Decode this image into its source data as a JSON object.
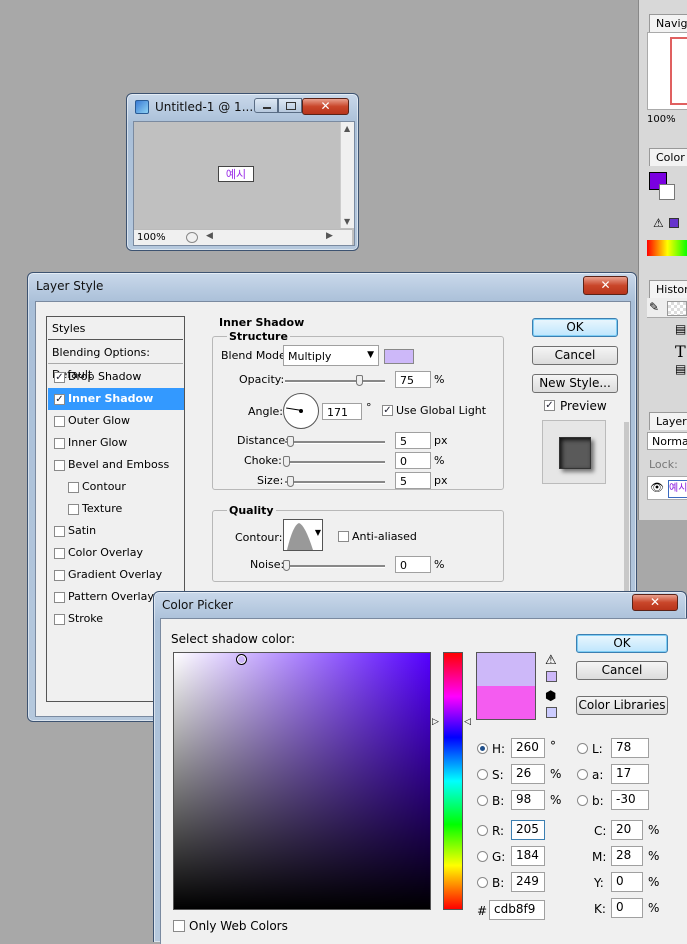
{
  "doc_window": {
    "title": "Untitled-1 @ 1...",
    "zoom": "100%",
    "content_text": "예시"
  },
  "right_panels": {
    "navigator_tab": "Navigat",
    "navigator_zoom": "100%",
    "color_tab": "Color",
    "history_tab": "History",
    "layers_tab": "Layers",
    "blend_mode": "Normal",
    "lock_label": "Lock:",
    "layer_name": "예시",
    "fg_color": "#7a00e0",
    "history_item": "T"
  },
  "layer_style": {
    "title": "Layer Style",
    "ok": "OK",
    "cancel": "Cancel",
    "new_style": "New Style...",
    "preview_label": "Preview",
    "styles_header": "Styles",
    "blending_options": "Blending Options: Default",
    "items": [
      {
        "label": "Drop Shadow",
        "checked": true,
        "selected": false,
        "indent": false
      },
      {
        "label": "Inner Shadow",
        "checked": true,
        "selected": true,
        "indent": false
      },
      {
        "label": "Outer Glow",
        "checked": false,
        "selected": false,
        "indent": false
      },
      {
        "label": "Inner Glow",
        "checked": false,
        "selected": false,
        "indent": false
      },
      {
        "label": "Bevel and Emboss",
        "checked": false,
        "selected": false,
        "indent": false
      },
      {
        "label": "Contour",
        "checked": false,
        "selected": false,
        "indent": true
      },
      {
        "label": "Texture",
        "checked": false,
        "selected": false,
        "indent": true
      },
      {
        "label": "Satin",
        "checked": false,
        "selected": false,
        "indent": false
      },
      {
        "label": "Color Overlay",
        "checked": false,
        "selected": false,
        "indent": false
      },
      {
        "label": "Gradient Overlay",
        "checked": false,
        "selected": false,
        "indent": false
      },
      {
        "label": "Pattern Overlay",
        "checked": false,
        "selected": false,
        "indent": false
      },
      {
        "label": "Stroke",
        "checked": false,
        "selected": false,
        "indent": false
      }
    ],
    "section_title": "Inner Shadow",
    "structure_title": "Structure",
    "blend_mode_label": "Blend Mode:",
    "blend_mode_value": "Multiply",
    "shadow_color": "#cdb8f9",
    "opacity_label": "Opacity:",
    "opacity_value": "75",
    "opacity_unit": "%",
    "opacity_fraction": 0.75,
    "angle_label": "Angle:",
    "angle_value": "171",
    "angle_unit": "°",
    "use_global_light": "Use Global Light",
    "distance_label": "Distance:",
    "distance_value": "5",
    "distance_unit": "px",
    "choke_label": "Choke:",
    "choke_value": "0",
    "choke_unit": "%",
    "size_label": "Size:",
    "size_value": "5",
    "size_unit": "px",
    "quality_title": "Quality",
    "contour_label": "Contour:",
    "anti_aliased": "Anti-aliased",
    "noise_label": "Noise:",
    "noise_value": "0",
    "noise_unit": "%"
  },
  "color_picker": {
    "title": "Color Picker",
    "prompt": "Select shadow color:",
    "ok": "OK",
    "cancel": "Cancel",
    "color_libraries": "Color Libraries",
    "new_color": "#cdb8f9",
    "old_color": "#f45cf0",
    "hue_color": "#5500ff",
    "fields": {
      "H": {
        "label": "H:",
        "value": "260",
        "unit": "°"
      },
      "S": {
        "label": "S:",
        "value": "26",
        "unit": "%"
      },
      "B": {
        "label": "B:",
        "value": "98",
        "unit": "%"
      },
      "R": {
        "label": "R:",
        "value": "205",
        "unit": ""
      },
      "G": {
        "label": "G:",
        "value": "184",
        "unit": ""
      },
      "Bl": {
        "label": "B:",
        "value": "249",
        "unit": ""
      },
      "L": {
        "label": "L:",
        "value": "78",
        "unit": ""
      },
      "a": {
        "label": "a:",
        "value": "17",
        "unit": ""
      },
      "b": {
        "label": "b:",
        "value": "-30",
        "unit": ""
      },
      "C": {
        "label": "C:",
        "value": "20",
        "unit": "%"
      },
      "M": {
        "label": "M:",
        "value": "28",
        "unit": "%"
      },
      "Y": {
        "label": "Y:",
        "value": "0",
        "unit": "%"
      },
      "K": {
        "label": "K:",
        "value": "0",
        "unit": "%"
      }
    },
    "hex_label": "#",
    "hex_value": "cdb8f9",
    "only_web_colors": "Only Web Colors"
  }
}
